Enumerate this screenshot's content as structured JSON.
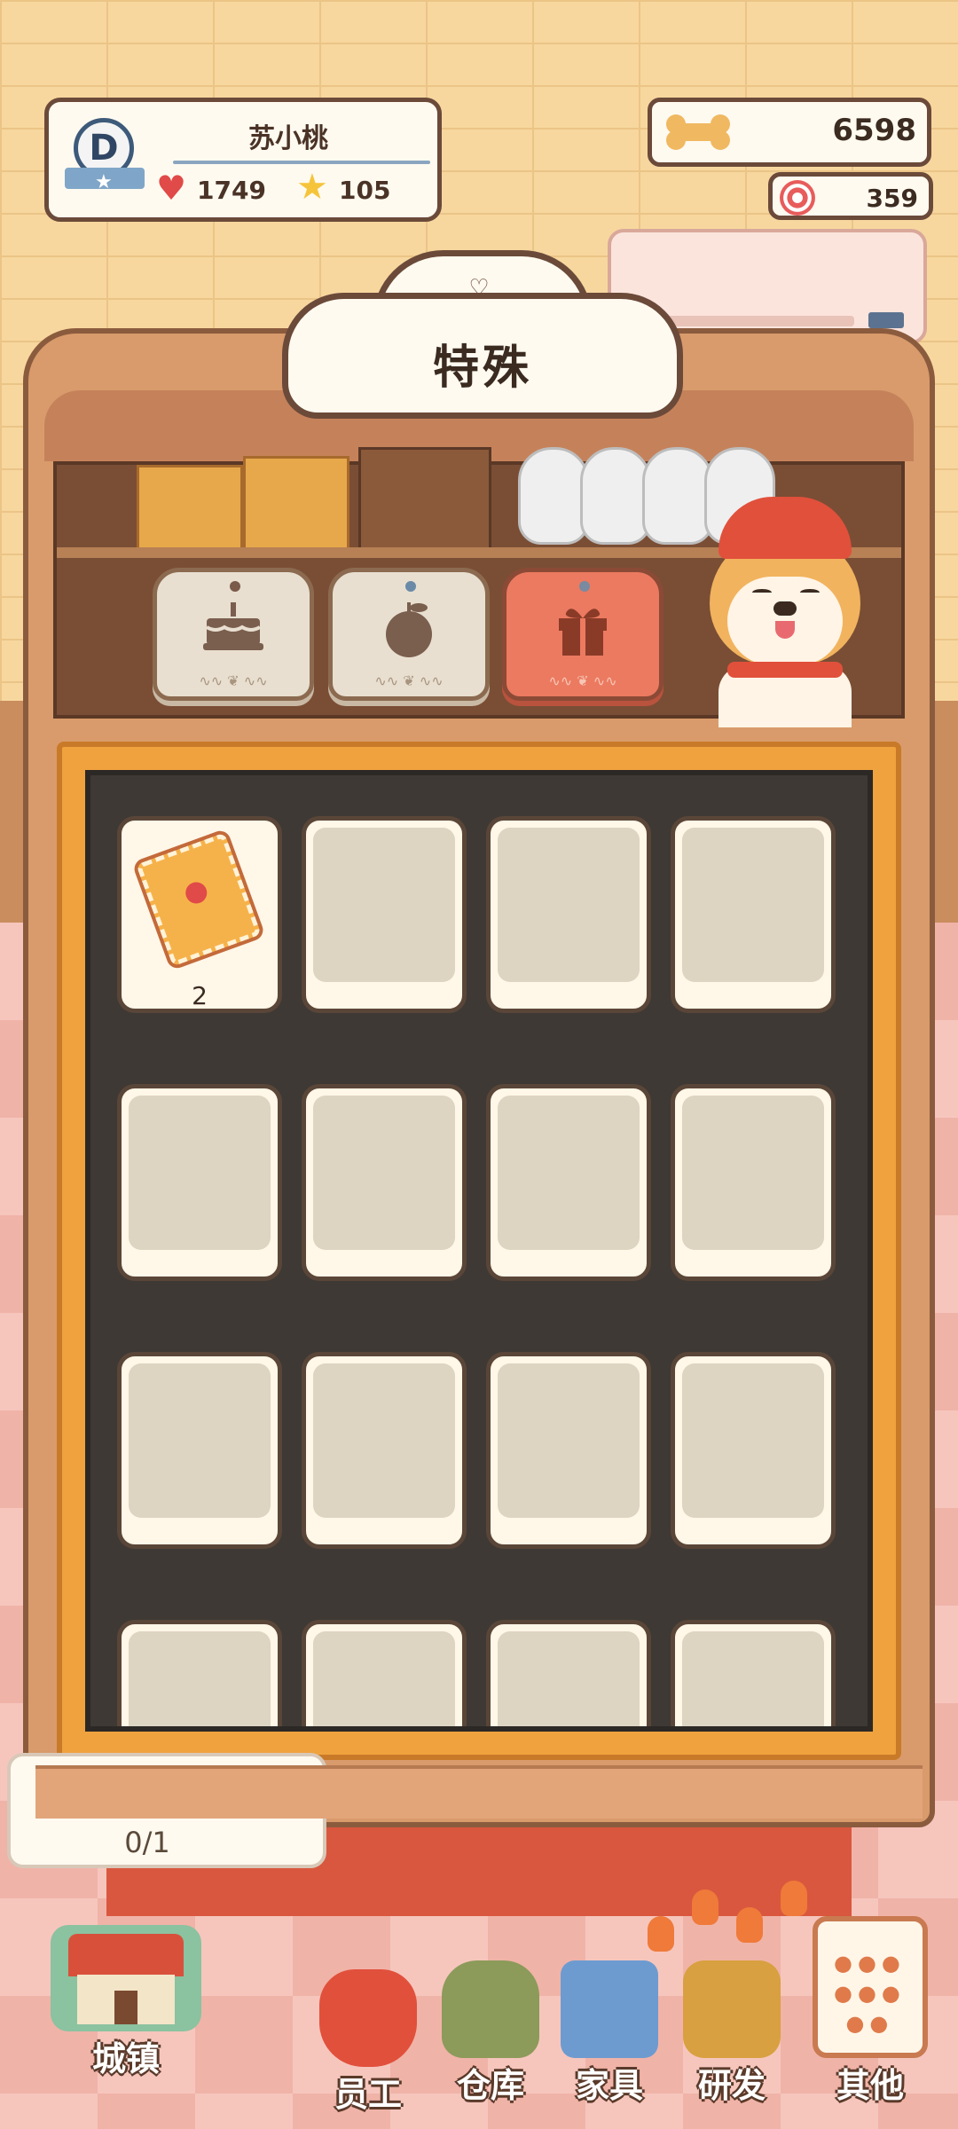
{
  "profile": {
    "rank_letter": "D",
    "player_name": "苏小桃",
    "hearts": "1749",
    "stars": "105"
  },
  "currency": {
    "bones": "6598",
    "candy": "359"
  },
  "storage": {
    "title": "特殊",
    "tabs": [
      {
        "label_icon": "cake-icon",
        "active": false
      },
      {
        "label_icon": "apple-icon",
        "active": false
      },
      {
        "label_icon": "gift-icon",
        "active": true
      }
    ],
    "slots_first_count": "2"
  },
  "quest": {
    "progress": "0/1"
  },
  "nav": {
    "town": "城镇",
    "staff": "员工",
    "storage": "仓库",
    "furniture": "家具",
    "research": "研发",
    "other": "其他"
  },
  "colors": {
    "accent": "#ec7a60",
    "board": "#3e3935",
    "frame": "#f0a23e"
  }
}
